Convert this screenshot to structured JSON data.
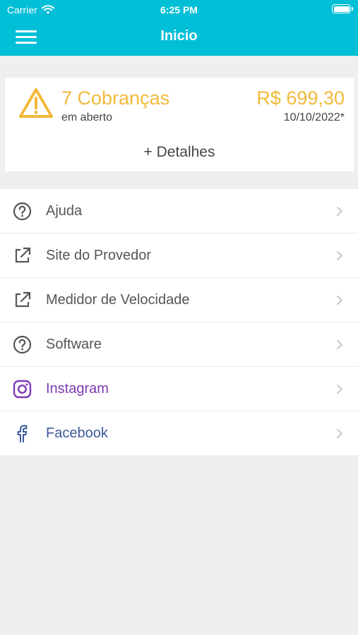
{
  "status_bar": {
    "carrier": "Carrier",
    "time": "6:25 PM",
    "icons": [
      "wifi-icon",
      "battery-icon"
    ]
  },
  "nav": {
    "title": "Inicio",
    "menu_icon": "hamburger-menu-icon"
  },
  "summary_card": {
    "icon": "warning-triangle-icon",
    "charges_title": "7 Cobranças",
    "charges_subtitle": "em aberto",
    "amount": "R$ 699,30",
    "due_date": "10/10/2022*",
    "details_label": "+ Detalhes"
  },
  "menu": {
    "items": [
      {
        "label": "Ajuda",
        "icon": "question-circle-icon"
      },
      {
        "label": "Site do Provedor",
        "icon": "external-link-icon"
      },
      {
        "label": "Medidor de Velocidade",
        "icon": "external-link-icon"
      },
      {
        "label": "Software",
        "icon": "question-circle-icon"
      },
      {
        "label": "Instagram",
        "icon": "instagram-icon"
      },
      {
        "label": "Facebook",
        "icon": "facebook-icon"
      }
    ]
  },
  "colors": {
    "header": "#00bfd6",
    "warning": "#f2b93b",
    "instagram": "#7e39b2",
    "facebook": "#3b5998",
    "background": "#efefef"
  }
}
